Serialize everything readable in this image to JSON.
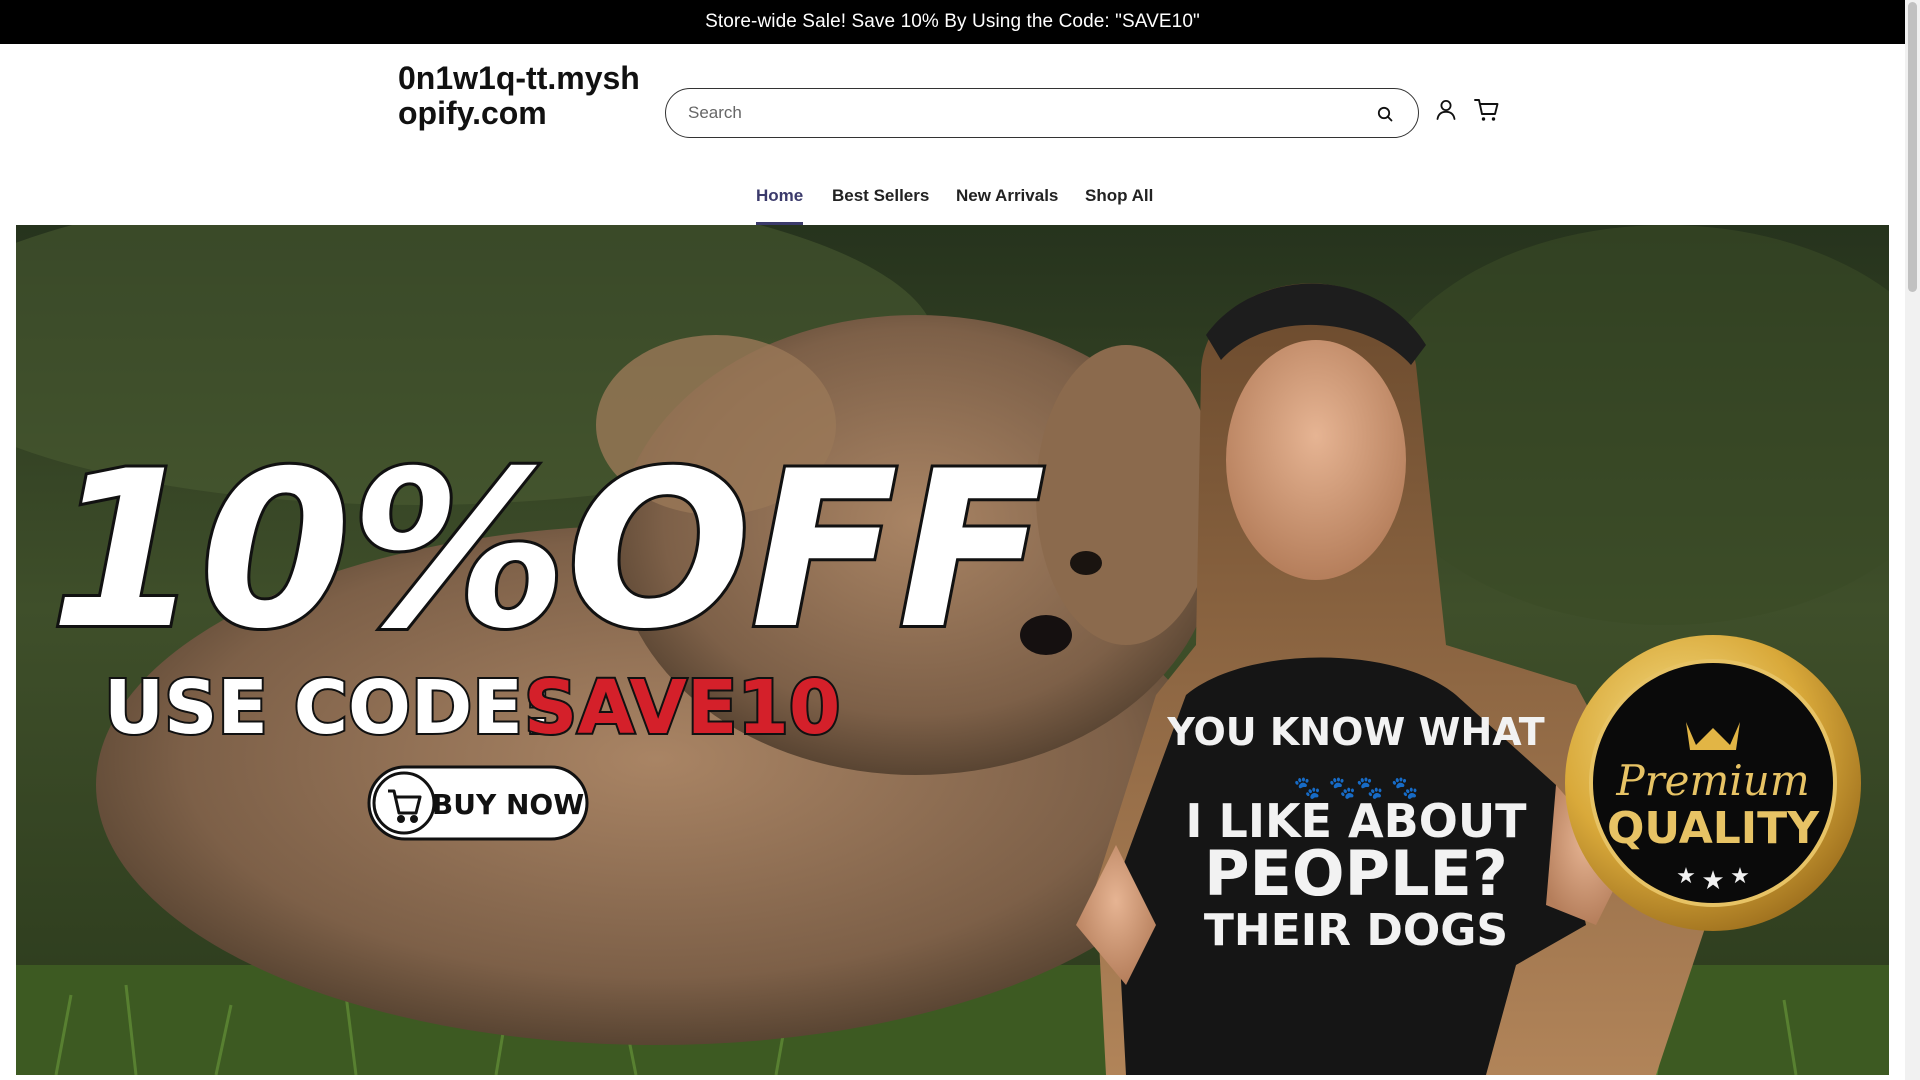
{
  "announcement": {
    "text": "Store-wide Sale! Save 10% By Using the Code: \"SAVE10\""
  },
  "header": {
    "logo_text": "0n1w1q-tt.myshopify.com",
    "search": {
      "placeholder": "Search",
      "value": ""
    },
    "icons": {
      "search": "search-icon",
      "account": "account-icon",
      "cart": "cart-icon"
    }
  },
  "nav": {
    "items": [
      {
        "label": "Home",
        "active": true
      },
      {
        "label": "Best Sellers",
        "active": false
      },
      {
        "label": "New Arrivals",
        "active": false
      },
      {
        "label": "Shop All",
        "active": false
      }
    ]
  },
  "hero": {
    "headline": "10%OFF",
    "code_prefix": "USE CODE:",
    "code": "SAVE10",
    "cta_label": "BUY NOW",
    "shirt_line1": "YOU KNOW WHAT",
    "shirt_line2": "I LIKE ABOUT",
    "shirt_line3": "PEOPLE?",
    "shirt_line4": "THEIR DOGS",
    "badge_line1": "Premium",
    "badge_line2": "QUALITY"
  },
  "colors": {
    "accent": "#3b3a6b",
    "announcement_bg": "#000000",
    "code_red": "#d4202a",
    "badge_gold": "#d9a93a"
  }
}
